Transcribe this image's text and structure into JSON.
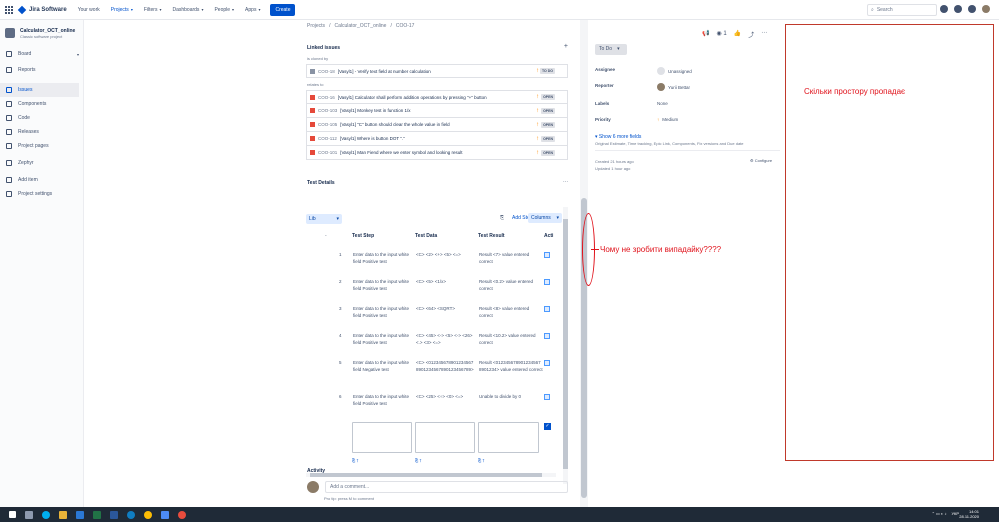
{
  "topnav": {
    "product": "Jira Software",
    "items": [
      {
        "label": "Your work",
        "chevron": false,
        "active": false
      },
      {
        "label": "Projects",
        "chevron": true,
        "active": true
      },
      {
        "label": "Filters",
        "chevron": true,
        "active": false
      },
      {
        "label": "Dashboards",
        "chevron": true,
        "active": false
      },
      {
        "label": "People",
        "chevron": true,
        "active": false
      },
      {
        "label": "Apps",
        "chevron": true,
        "active": false
      }
    ],
    "create_label": "Create",
    "search_placeholder": "Search"
  },
  "sidebar": {
    "project_name": "Calculator_OCT_online",
    "project_type": "Classic software project",
    "items": [
      {
        "label": "Board",
        "active": false
      },
      {
        "label": "Reports",
        "active": false
      },
      {
        "label": "Issues",
        "active": true
      },
      {
        "label": "Components",
        "active": false
      },
      {
        "label": "Code",
        "active": false
      },
      {
        "label": "Releases",
        "active": false
      },
      {
        "label": "Project pages",
        "active": false
      },
      {
        "label": "Zephyr",
        "active": false
      },
      {
        "label": "Add item",
        "active": false
      },
      {
        "label": "Project settings",
        "active": false
      }
    ]
  },
  "breadcrumb": [
    "Projects",
    "/",
    "Calculator_OCT_online",
    "/",
    "COO-17"
  ],
  "linked": {
    "title": "Linked issues",
    "cloned_by": "is cloned by",
    "relates_to": "relates to",
    "clone_issue": {
      "key": "COO-18",
      "summary": "[Vasyl1] - Verify text field at number calculation",
      "status": "TO DO"
    },
    "issues": [
      {
        "key": "COO-16",
        "summary": "[Vasyl1] Calculator shall perform addition operations by pressing \"+\" button",
        "status": "OPEN"
      },
      {
        "key": "COO-103",
        "summary": "[Vasyl1] Monkey test in function 1/x",
        "status": "OPEN"
      },
      {
        "key": "COO-105",
        "summary": "[Vasyl1] \"C\" button should clear the whole value in field",
        "status": "OPEN"
      },
      {
        "key": "COO-112",
        "summary": "[Vasyl1] Where is button DOT \".\"",
        "status": "OPEN"
      },
      {
        "key": "COO-101",
        "summary": "[Vasyl1] Man Fiend where we enter symbol and looking result",
        "status": "OPEN"
      }
    ]
  },
  "test_details": {
    "title": "Test Details",
    "library_label": "Lib",
    "add_steps": "Add Steps",
    "columns": "Columns",
    "headers": [
      "Test Step",
      "Test Data",
      "Test Result",
      "Acti"
    ],
    "rows": [
      {
        "n": "1",
        "step": "Enter data to the input white field Positive test",
        "data": "<C> <2> <+> <5> <=>",
        "result": "Result <7> value entered correct"
      },
      {
        "n": "2",
        "step": "Enter data to the input white field Positive test",
        "data": "<C> <5> <1/x>",
        "result": "Result <0.2> value entered correct"
      },
      {
        "n": "3",
        "step": "Enter data to the input white field Positive test",
        "data": "<C> <64> <SQRT>",
        "result": "Result <8> value entered correct"
      },
      {
        "n": "4",
        "step": "Enter data to the input white field Positive test",
        "data": "<C> <45> <-> <5> <-> <26> <.> <3> <=>",
        "result": "Result <10.2> value entered correct"
      },
      {
        "n": "5",
        "step": "Enter data to the input white field Negative test",
        "data": "<C> <0123456789012345678901234567890123456789>",
        "result": "Result <0123456789012345678901234> value entered correct"
      },
      {
        "n": "6",
        "step": "Enter data to the input white field Positive test",
        "data": "<C> <25> <÷> <0> <=>",
        "result": "Unable to divide by 0"
      }
    ]
  },
  "activity": {
    "title": "Activity",
    "comment_placeholder": "Add a comment...",
    "tip": "Pro tip: press M to comment"
  },
  "details": {
    "status": "To Do",
    "watch_count": "1",
    "fields": [
      {
        "label": "Assignee",
        "value": "Unassigned",
        "icon": "avatar-empty"
      },
      {
        "label": "Reporter",
        "value": "Yurii Bettar",
        "icon": "avatar"
      },
      {
        "label": "Labels",
        "value": "None",
        "icon": ""
      },
      {
        "label": "Priority",
        "value": "Medium",
        "icon": "priority-arrow"
      }
    ],
    "show_more": "Show 6 more fields",
    "show_more_sub": "Original Estimate, Time tracking, Epic Link, Components, Fix versions and Due date",
    "created": "Created 21 hours ago",
    "updated": "Updated 1 hour ago",
    "configure": "Configure"
  },
  "annotations": {
    "space_wasted": "Скільки простору пропадає",
    "why_no_dropdown": "Чому не зробити випадайку????"
  },
  "taskbar": {
    "lang": "УКР",
    "time": "14:01",
    "date": "28.11.2020"
  },
  "colors": {
    "accent": "#0052cc",
    "annotation": "#e0121b"
  }
}
